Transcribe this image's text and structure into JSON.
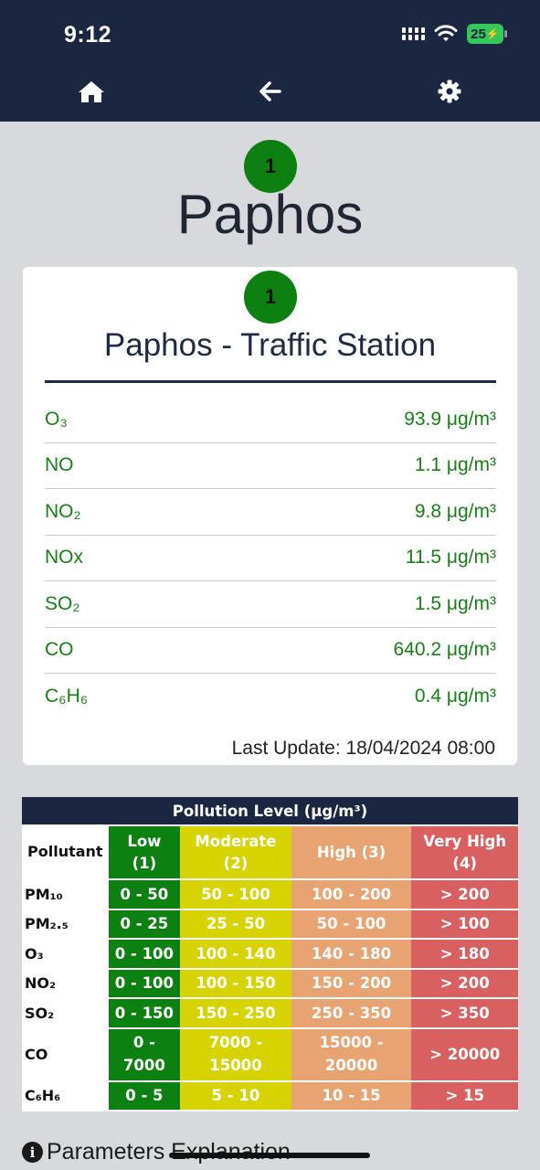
{
  "status_bar": {
    "time": "9:12",
    "battery": "25"
  },
  "city": {
    "aqi_level": "1",
    "name": "Paphos"
  },
  "station": {
    "aqi_level": "1",
    "name": "Paphos - Traffic Station",
    "readings": [
      {
        "pollutant": "O₃",
        "value": "93.9 μg/m³"
      },
      {
        "pollutant": "NO",
        "value": "1.1 μg/m³"
      },
      {
        "pollutant": "NO₂",
        "value": "9.8 μg/m³"
      },
      {
        "pollutant": "NOx",
        "value": "11.5 μg/m³"
      },
      {
        "pollutant": "SO₂",
        "value": "1.5 μg/m³"
      },
      {
        "pollutant": "CO",
        "value": "640.2 μg/m³"
      },
      {
        "pollutant": "C₆H₆",
        "value": "0.4 μg/m³"
      }
    ],
    "last_update": "Last Update: 18/04/2024 08:00"
  },
  "pollution_table": {
    "title": "Pollution Level (μg/m³)",
    "headers": [
      "Pollutant",
      "Low (1)",
      "Moderate (2)",
      "High (3)",
      "Very High (4)"
    ],
    "rows": [
      {
        "name": "PM₁₀",
        "low": "0 - 50",
        "moderate": "50 - 100",
        "high": "100 - 200",
        "very_high": "> 200"
      },
      {
        "name": "PM₂.₅",
        "low": "0 - 25",
        "moderate": "25 - 50",
        "high": "50 - 100",
        "very_high": "> 100"
      },
      {
        "name": "O₃",
        "low": "0 - 100",
        "moderate": "100 - 140",
        "high": "140 - 180",
        "very_high": "> 180"
      },
      {
        "name": "NO₂",
        "low": "0 - 100",
        "moderate": "100 - 150",
        "high": "150 - 200",
        "very_high": "> 200"
      },
      {
        "name": "SO₂",
        "low": "0 - 150",
        "moderate": "150 - 250",
        "high": "250 - 350",
        "very_high": "> 350"
      },
      {
        "name": "CO",
        "low": "0 - 7000",
        "moderate": "7000 - 15000",
        "high": "15000 - 20000",
        "very_high": "> 20000"
      },
      {
        "name": "C₆H₆",
        "low": "0 - 5",
        "moderate": "5 - 10",
        "high": "10 - 15",
        "very_high": "> 15"
      }
    ]
  },
  "explanation_link": "Parameters Explanation",
  "colors": {
    "low": "#0c8011",
    "moderate": "#d6d300",
    "high": "#e8a373",
    "very_high": "#d96060",
    "navbar": "#1b2640"
  },
  "icons": {
    "home": "home-icon",
    "back": "arrow-left-icon",
    "settings": "gear-icon",
    "info": "info-circle-icon"
  }
}
